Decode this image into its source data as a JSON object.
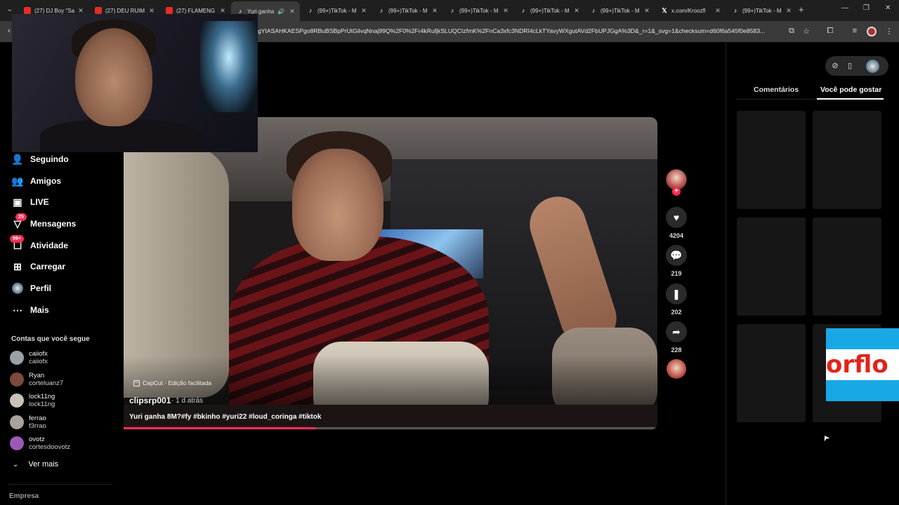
{
  "browser": {
    "tabs": [
      {
        "icon": "youtube",
        "label": "(27) DJ Boy \"Sa"
      },
      {
        "icon": "youtube",
        "label": "(27) DEU RUIM"
      },
      {
        "icon": "youtube",
        "label": "(27) FLAMENG"
      },
      {
        "icon": "tiktok",
        "label": "Yuri ganha",
        "active": true
      },
      {
        "icon": "tiktok",
        "label": "(99+)TikTok - M"
      },
      {
        "icon": "tiktok",
        "label": "(99+)TikTok - M"
      },
      {
        "icon": "tiktok",
        "label": "(99+)TikTok - M"
      },
      {
        "icon": "tiktok",
        "label": "(99+)TikTok - M"
      },
      {
        "icon": "tiktok",
        "label": "(99+)TikTok - M"
      },
      {
        "icon": "x",
        "label": "x.com/Kroozfl"
      },
      {
        "icon": "tiktok",
        "label": "(99+)TikTok - M"
      }
    ],
    "url": "gYIASAHKAESPgo8RBuBSBpPrUtGilvqNnaj99Q%2F0%2Fr4kRufjkSLUQCIzfmK%2FnCa3xfc3NDRI4cLkTYavyWXgutAVd2FbUPJGgA%3D&_r=1&_svg=1&checksum=d60f6a545f0e8583..."
  },
  "nav": {
    "items": [
      {
        "label": "Seguindo",
        "icon": "following-icon"
      },
      {
        "label": "Amigos",
        "icon": "friends-icon"
      },
      {
        "label": "LIVE",
        "icon": "live-icon"
      },
      {
        "label": "Mensagens",
        "icon": "messages-icon",
        "badge": "25"
      },
      {
        "label": "Atividade",
        "icon": "activity-icon",
        "badge": "99+"
      },
      {
        "label": "Carregar",
        "icon": "upload-icon"
      },
      {
        "label": "Perfil",
        "icon": "profile-icon"
      },
      {
        "label": "Mais",
        "icon": "more-icon"
      }
    ],
    "following_title": "Contas que você segue",
    "accounts": [
      {
        "name": "caiiofx",
        "handle": "caiiofx",
        "color": "#9aa2a8"
      },
      {
        "name": "Ryan",
        "handle": "corteluanz7",
        "color": "#7a4a3a"
      },
      {
        "name": "lock11ng",
        "handle": "lock11ng",
        "color": "#c9c2bb"
      },
      {
        "name": "ferrao",
        "handle": "f3rrao",
        "color": "#a8a29e"
      },
      {
        "name": "ovotz",
        "handle": "cortesdoovotz",
        "color": "#9b59b6"
      }
    ],
    "see_more": "Ver mais",
    "footer": "Empresa"
  },
  "video": {
    "watermark": "CapCut · Edição facilitada",
    "author": "clipsrp001",
    "posted": "· 1 d atrás",
    "caption": "Yuri ganha 8M?#fy #bkinho #yuri22 #loud_coringa #tiktok",
    "progress": 0.36
  },
  "actions": {
    "likes": "4204",
    "comments": "219",
    "saves": "202",
    "shares": "228"
  },
  "right_panel": {
    "tabs": [
      "Comentários",
      "Você pode gostar"
    ],
    "active_tab": "Você pode gostar",
    "ad_text": "orflo"
  },
  "colors": {
    "accent": "#fe2c55",
    "background": "#000000"
  }
}
